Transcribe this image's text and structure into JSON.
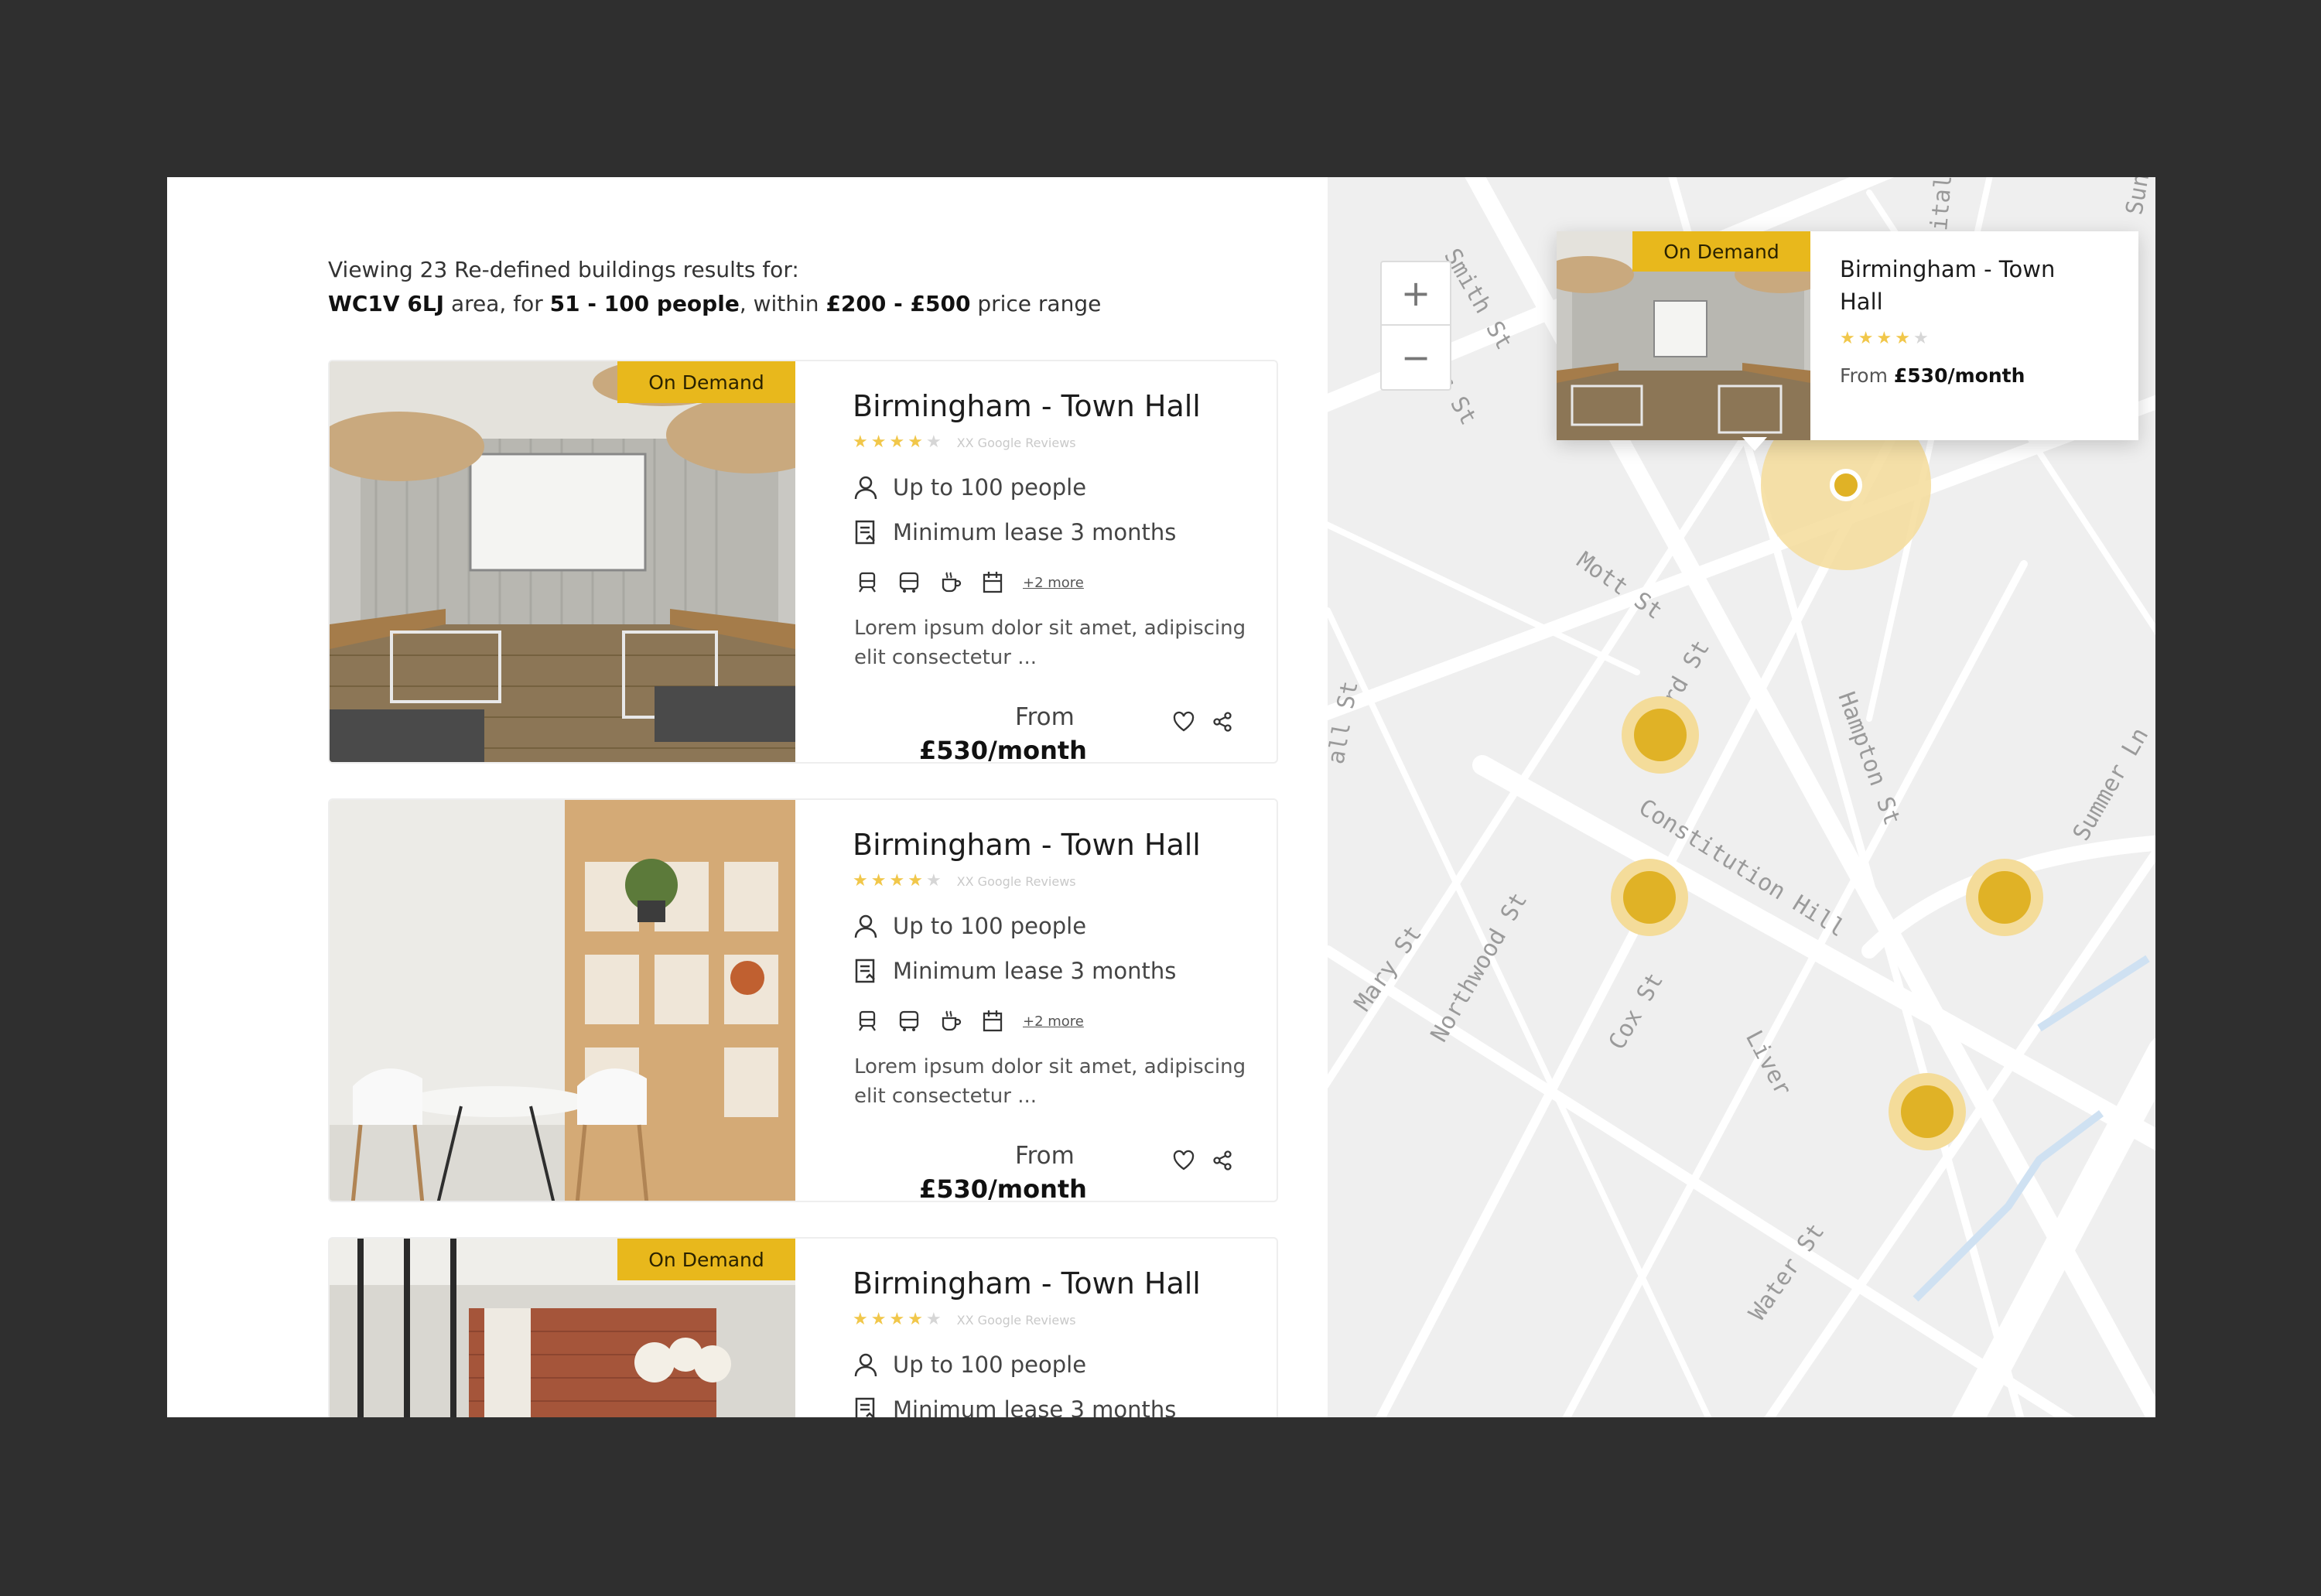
{
  "summary": {
    "line1": "Viewing 23 Re-defined buildings results for:",
    "area": "WC1V 6LJ",
    "area_suffix": " area, for ",
    "people": "51 - 100 people",
    "within": ", within ",
    "price_range": "£200 - £500",
    "price_suffix": " price range"
  },
  "colors": {
    "accent": "#e8b81c",
    "star": "#f1c74a",
    "marker": "#e0b226"
  },
  "listings": [
    {
      "badge": "On Demand",
      "title": "Birmingham - Town Hall",
      "rating": 4,
      "reviews": "XX Google Reviews",
      "capacity": "Up to 100 people",
      "lease": "Minimum lease 3 months",
      "amenities": [
        "train-icon",
        "bus-icon",
        "coffee-icon",
        "parking-icon"
      ],
      "more": "+2 more",
      "description": "Lorem ipsum dolor sit amet, adipiscing elit consectetur ...",
      "from": "From",
      "price": "£530/month"
    },
    {
      "badge": "",
      "title": "Birmingham - Town Hall",
      "rating": 4,
      "reviews": "XX Google Reviews",
      "capacity": "Up to 100 people",
      "lease": "Minimum lease 3 months",
      "amenities": [
        "train-icon",
        "bus-icon",
        "coffee-icon",
        "parking-icon"
      ],
      "more": "+2 more",
      "description": "Lorem ipsum dolor sit amet, adipiscing elit consectetur ...",
      "from": "From",
      "price": "£530/month"
    },
    {
      "badge": "On Demand",
      "title": "Birmingham - Town Hall",
      "rating": 4,
      "reviews": "XX Google Reviews",
      "capacity": "Up to 100 people",
      "lease": "Minimum lease 3 months"
    }
  ],
  "map": {
    "zoom_in": "+",
    "zoom_out": "−",
    "popup": {
      "badge": "On Demand",
      "title": "Birmingham - Town Hall",
      "rating": 4,
      "from": "From ",
      "price": "£530/month"
    },
    "streets": [
      "Smith St",
      "r St",
      "Mott St",
      "ard St",
      "all St",
      "Hampton St",
      "Constitution Hill",
      "Summer Ln",
      "Mary St",
      "Northwood St",
      "Cox St",
      "Liver",
      "Water St",
      "Sun",
      "ital"
    ]
  }
}
